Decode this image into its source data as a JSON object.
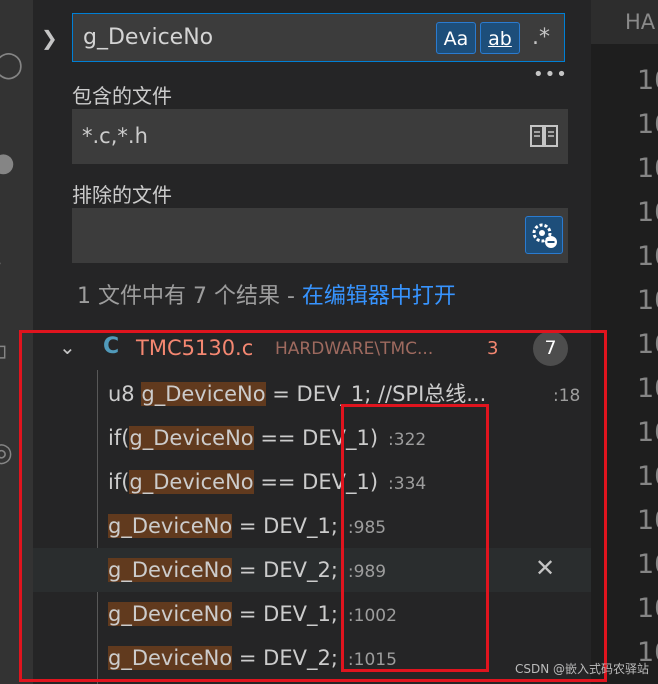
{
  "search": {
    "value": "g_DeviceNo",
    "match_case_label": "Aa",
    "whole_word_label": "ab",
    "regex_label": ".*",
    "more_label": "•••"
  },
  "include": {
    "label": "包含的文件",
    "value": "*.c,*.h",
    "icon": "book-icon"
  },
  "exclude": {
    "label": "排除的文件",
    "value": "",
    "icon": "settings-exclude-icon"
  },
  "summary": {
    "text": "1 文件中有 7 个结果 - ",
    "link": "在编辑器中打开"
  },
  "file": {
    "language_icon": "C",
    "name": "TMC5130.c",
    "path": "HARDWARE\\TMC...",
    "count": "3",
    "badge": "7"
  },
  "results": [
    {
      "prefix": "u8 ",
      "match": "g_DeviceNo",
      "suffix": " = DEV_1; //SPI总线...",
      "line": ":18"
    },
    {
      "prefix": "if(",
      "match": "g_DeviceNo",
      "suffix": " == DEV_1)",
      "line": ":322"
    },
    {
      "prefix": "if(",
      "match": "g_DeviceNo",
      "suffix": " == DEV_1)",
      "line": ":334"
    },
    {
      "prefix": "",
      "match": "g_DeviceNo",
      "suffix": " = DEV_1;",
      "line": ":985"
    },
    {
      "prefix": "",
      "match": "g_DeviceNo",
      "suffix": " = DEV_2;",
      "line": ":989"
    },
    {
      "prefix": "",
      "match": "g_DeviceNo",
      "suffix": " = DEV_1;",
      "line": ":1002"
    },
    {
      "prefix": "",
      "match": "g_DeviceNo",
      "suffix": " = DEV_2;",
      "line": ":1015"
    }
  ],
  "close_label": "✕",
  "editor": {
    "tab_label": "HA",
    "line_numbers": [
      "10",
      "10",
      "10",
      "10",
      "10",
      "10",
      "10",
      "10",
      "10",
      "10",
      "10",
      "10",
      "10",
      "10",
      "10",
      "10"
    ]
  },
  "watermark": "CSDN @嵌入式码农驿站",
  "colors": {
    "accent": "#007fd4",
    "match_highlight": "#613a1e",
    "annotation_red": "#e0141e",
    "link": "#3794ff"
  }
}
